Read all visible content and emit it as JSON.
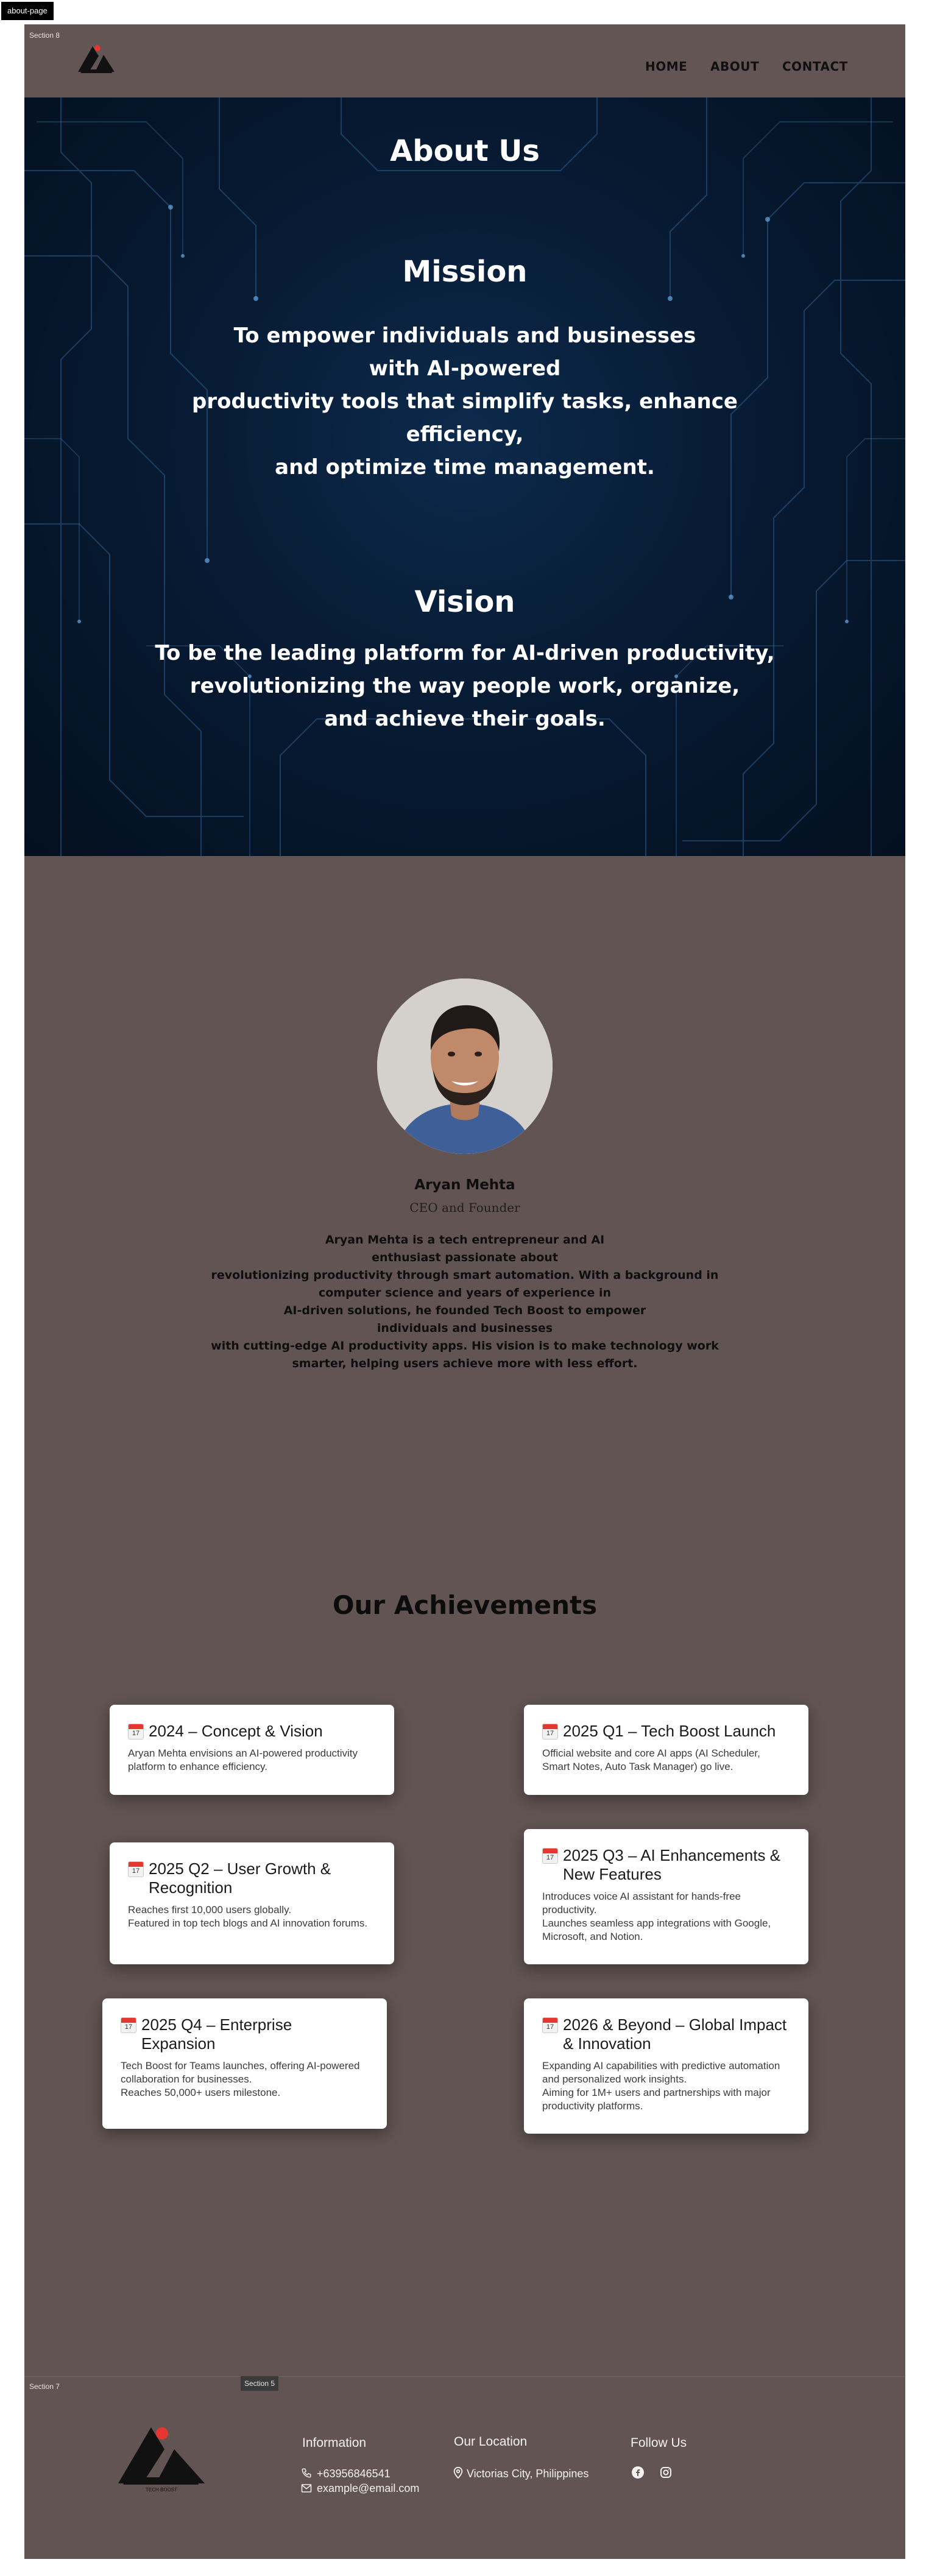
{
  "page_tag": "about-page",
  "section_labels": {
    "top": "Section 8",
    "footer_left": "Section 7",
    "footer_mid": "Section 5"
  },
  "nav": {
    "home": "HOME",
    "about": "ABOUT",
    "contact": "CONTACT"
  },
  "hero": {
    "title": "About Us",
    "mission_heading": "Mission",
    "mission_lines": [
      "To empower individuals and businesses",
      "with AI-powered",
      "productivity tools that simplify tasks, enhance",
      "efficiency,",
      "and optimize time management."
    ],
    "vision_heading": "Vision",
    "vision_lines": [
      "To be the leading platform for AI-driven productivity,",
      "revolutionizing the way people work, organize,",
      "and achieve their goals."
    ]
  },
  "founder": {
    "name": "Aryan Mehta",
    "role": "CEO and Founder",
    "bio_lines": [
      "Aryan Mehta is a tech entrepreneur and AI",
      "enthusiast passionate about",
      "revolutionizing productivity through smart automation. With a background in",
      "computer science and years of experience in",
      "AI-driven solutions, he founded Tech Boost to empower",
      "individuals and businesses",
      "with cutting-edge AI productivity apps. His vision is to make technology work",
      "smarter, helping users achieve more with less effort."
    ]
  },
  "achievements": {
    "heading": "Our Achievements",
    "items": [
      {
        "title": "2024 – Concept & Vision",
        "lines": [
          "Aryan Mehta envisions an AI-powered productivity platform to enhance efficiency."
        ]
      },
      {
        "title": "2025 Q1 – Tech Boost Launch",
        "lines": [
          "Official website and core AI apps (AI Scheduler, Smart Notes, Auto Task Manager) go live."
        ]
      },
      {
        "title": "2025 Q2 – User Growth & Recognition",
        "lines": [
          "Reaches first 10,000 users globally.",
          "Featured in top tech blogs and AI innovation forums."
        ]
      },
      {
        "title": "2025 Q3 – AI Enhancements & New Features",
        "lines": [
          "Introduces voice AI assistant for hands-free productivity.",
          "Launches seamless app integrations with Google, Microsoft, and Notion."
        ]
      },
      {
        "title": "2025 Q4 – Enterprise Expansion",
        "lines": [
          "Tech Boost for Teams launches, offering AI-powered collaboration for businesses.",
          "Reaches 50,000+ users milestone."
        ]
      },
      {
        "title": "2026 & Beyond – Global Impact & Innovation",
        "lines": [
          "Expanding AI capabilities with predictive automation and personalized work insights.",
          "Aiming for 1M+ users and partnerships with major productivity platforms."
        ]
      }
    ]
  },
  "footer": {
    "logo_caption": "TECH BOOST",
    "info_heading": "Information",
    "phone": "+63956846541",
    "email": "example@email.com",
    "location_heading": "Our Location",
    "location": "Victorias City, Philippines",
    "follow_heading": "Follow Us"
  },
  "colors": {
    "brand_background": "#615453",
    "hero_background": "#081c36",
    "card_background": "#ffffff",
    "logo_accent": "#e3372f"
  },
  "icons": [
    "calendar-icon",
    "phone-icon",
    "mail-icon",
    "location-pin-icon",
    "facebook-icon",
    "instagram-icon"
  ]
}
